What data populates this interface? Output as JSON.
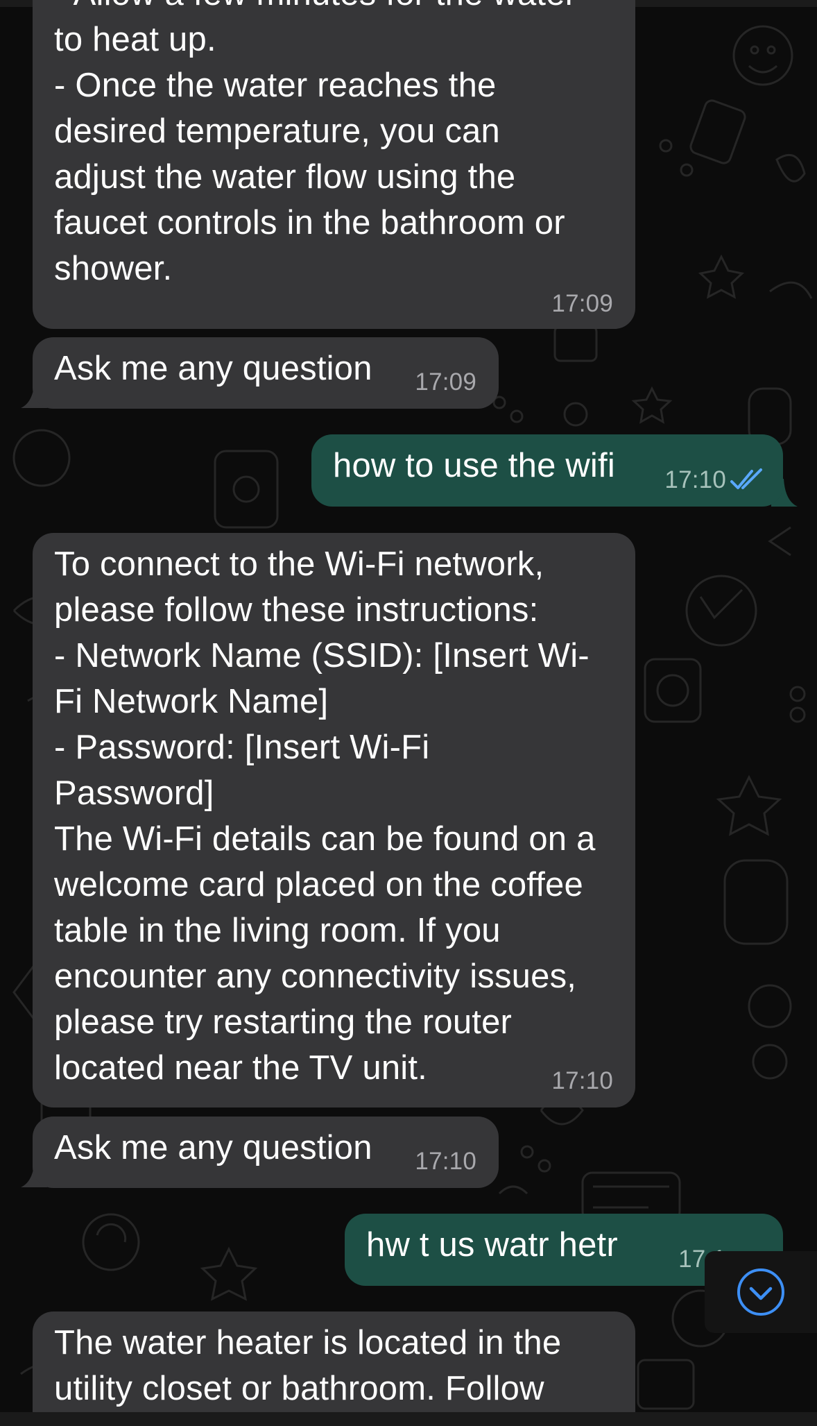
{
  "colors": {
    "background": "#0c0c0c",
    "incoming_bubble": "#363638",
    "outgoing_bubble": "#1d4f45",
    "timestamp": "#a9a9ad",
    "read_ticks": "#5aa9ff",
    "scroll_button_accent": "#3d8ff5"
  },
  "messages": [
    {
      "direction": "incoming",
      "text": "- Allow a few minutes for the water\nto heat up.\n- Once the water reaches the\ndesired temperature, you can\nadjust the water flow using the\nfaucet controls in the bathroom or\nshower.",
      "time": "17:09"
    },
    {
      "direction": "incoming",
      "text": "Ask me any question",
      "time": "17:09"
    },
    {
      "direction": "outgoing",
      "text": "how to use the wifi",
      "time": "17:10",
      "status_icon": "double-check-read-icon"
    },
    {
      "direction": "incoming",
      "text": "To connect to the Wi-Fi network,\nplease follow these instructions:\n- Network Name (SSID): [Insert Wi-\nFi Network Name]\n- Password: [Insert Wi-Fi\nPassword]\nThe Wi-Fi details can be found on a\nwelcome card placed on the coffee\ntable in the living room. If you\nencounter any connectivity issues,\nplease try restarting the router\nlocated near the TV unit.",
      "time": "17:10"
    },
    {
      "direction": "incoming",
      "text": "Ask me any question",
      "time": "17:10"
    },
    {
      "direction": "outgoing",
      "text": "hw t us watr hetr",
      "time": "17:1",
      "status_icon": "double-check-read-icon"
    },
    {
      "direction": "incoming",
      "text": "The water heater is located in the\nutility closet or bathroom. Follow",
      "time": ""
    }
  ],
  "scroll_button": {
    "icon": "chevron-down-circle-icon"
  }
}
